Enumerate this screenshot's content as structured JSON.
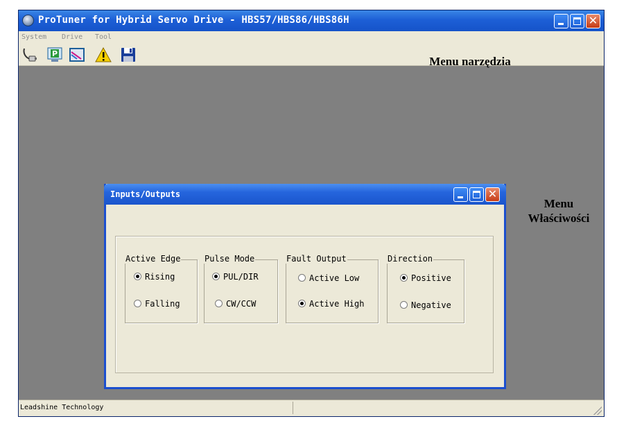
{
  "window": {
    "title": "ProTuner for Hybrid Servo Drive - HBS57/HBS86/HBS86H"
  },
  "menu": {
    "items": [
      "System",
      "Drive",
      "Tool"
    ]
  },
  "toolbar": {
    "icons": [
      "connect-cable-icon",
      "parameter-p-icon",
      "waveform-graph-icon",
      "warning-icon",
      "save-disk-icon"
    ]
  },
  "annotations": {
    "toolbar_note": "Menu narzędzia",
    "properties_note_line1": "Menu",
    "properties_note_line2": "Właściwości"
  },
  "dialog": {
    "title": "Inputs/Outputs",
    "groups": [
      {
        "label": "Active Edge",
        "options": [
          "Rising",
          "Falling"
        ],
        "selected": "Rising"
      },
      {
        "label": "Pulse Mode",
        "options": [
          "PUL/DIR",
          "CW/CCW"
        ],
        "selected": "PUL/DIR"
      },
      {
        "label": "Fault Output",
        "options": [
          "Active Low",
          "Active High"
        ],
        "selected": "Active High"
      },
      {
        "label": "Direction",
        "options": [
          "Positive",
          "Negative"
        ],
        "selected": "Positive"
      }
    ]
  },
  "status": {
    "text": "Leadshine Technology"
  },
  "colors": {
    "titlebar": "#1d5fd6",
    "workspace": "#808080",
    "face": "#ece9d8",
    "close": "#c63c16"
  }
}
